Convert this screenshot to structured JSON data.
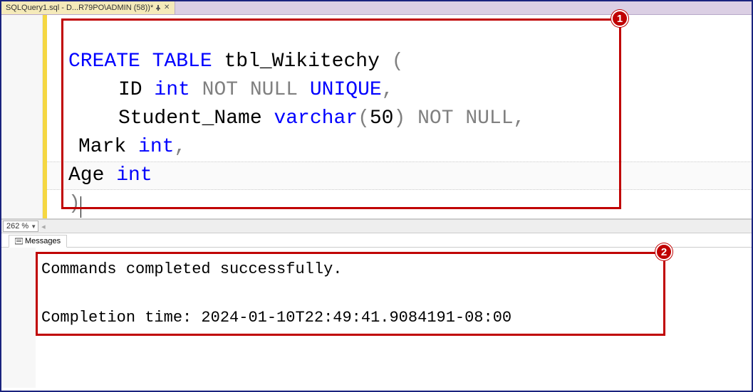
{
  "tab": {
    "title": "SQLQuery1.sql - D...R79PO\\ADMIN (58))*"
  },
  "code": {
    "l1a": "CREATE",
    "l1b": "TABLE",
    "l1c": " tbl_Wikitechy ",
    "l1d": "(",
    "l2a": "ID ",
    "l2b": "int",
    "l2c": " NOT",
    "l2d": " NULL",
    "l2e": " UNIQUE",
    "l2f": ",",
    "l3a": "Student_Name ",
    "l3b": "varchar",
    "l3c": "(",
    "l3d": "50",
    "l3e": ")",
    "l3f": " NOT",
    "l3g": " NULL",
    "l3h": ",",
    "l4a": "Mark ",
    "l4b": "int",
    "l4c": ",",
    "l5a": "Age ",
    "l5b": "int",
    "l6a": ")"
  },
  "zoom": {
    "value": "262 %"
  },
  "messagesTab": {
    "label": "Messages"
  },
  "messages": {
    "line1": "Commands completed successfully.",
    "blank": "",
    "line2": "Completion time: 2024-01-10T22:49:41.9084191-08:00"
  },
  "badges": {
    "one": "1",
    "two": "2"
  }
}
